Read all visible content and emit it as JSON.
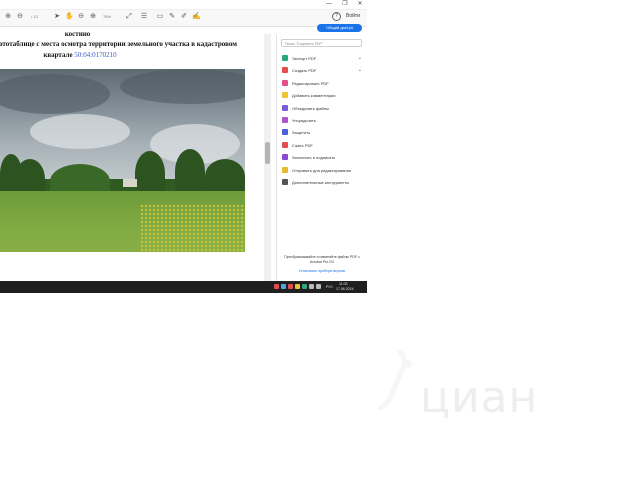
{
  "window": {
    "controls": {
      "minimize": "—",
      "maximize": "❐",
      "close": "✕"
    }
  },
  "toolbar": {
    "page_indicator": "/ 13",
    "zoom": "78%",
    "sign_in": "Войти",
    "help": "?",
    "share_button": "Общий доступ"
  },
  "document": {
    "line1": "костино",
    "line2": "Фототаблице с места осмотра территории земельного участка в кадастровом",
    "line3_text": "квартале",
    "line3_number": "50:04:0170210"
  },
  "tools_panel": {
    "search_placeholder": "Поиск \"Сократить PDF\"",
    "items": [
      {
        "label": "Экспорт PDF",
        "color": "#2aa87d",
        "has_chevron": true,
        "chevron": "⌄"
      },
      {
        "label": "Создать PDF",
        "color": "#e24e4e",
        "has_chevron": true,
        "chevron": "⌄"
      },
      {
        "label": "Редактировать PDF",
        "color": "#e04f8b",
        "has_chevron": false
      },
      {
        "label": "Добавить комментарии",
        "color": "#f1c232",
        "has_chevron": false
      },
      {
        "label": "Объединить файлы",
        "color": "#7a5cd6",
        "has_chevron": false
      },
      {
        "label": "Упорядочить",
        "color": "#b353c7",
        "has_chevron": false
      },
      {
        "label": "Защитить",
        "color": "#4a5fd6",
        "has_chevron": false
      },
      {
        "label": "Сжать PDF",
        "color": "#e04f4f",
        "has_chevron": false
      },
      {
        "label": "Заполнить и подписать",
        "color": "#8a4ad6",
        "has_chevron": false
      },
      {
        "label": "Отправить для редактирования",
        "color": "#e8b935",
        "has_chevron": false
      },
      {
        "label": "Дополнительные инструменты",
        "color": "#555555",
        "has_chevron": false
      }
    ],
    "promo_text": "Преобразовывайте и изменяйте файлы PDF с Acrobat Pro DC",
    "promo_link": "Установить пробную версию"
  },
  "taskbar": {
    "language": "РУС",
    "time": "11:03",
    "date": "17.06.2024"
  },
  "watermark": {
    "text": "циан"
  }
}
